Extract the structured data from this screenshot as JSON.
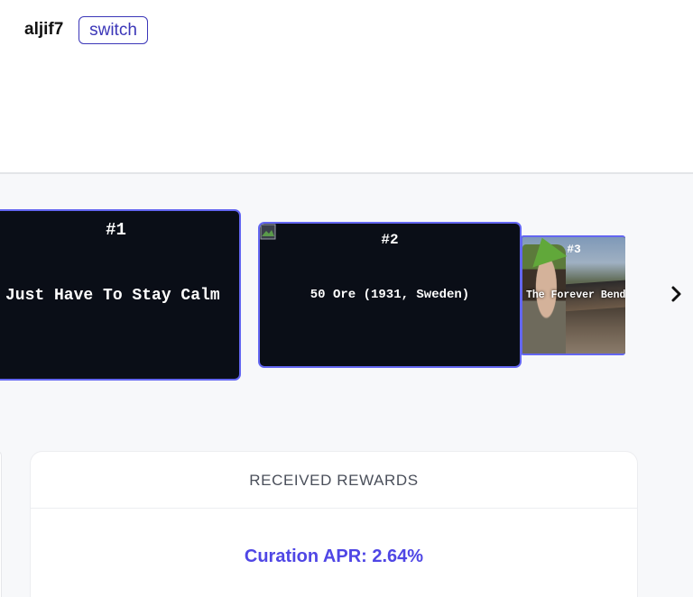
{
  "header": {
    "username": "aljif7",
    "switch_label": "switch"
  },
  "carousel": {
    "cards": [
      {
        "rank": "#1",
        "title": "Just Have To Stay Calm"
      },
      {
        "rank": "#2",
        "title": "50 Ore (1931, Sweden)",
        "thumbnail": "broken-image-icon"
      },
      {
        "rank": "#3",
        "title": "The Forever Bend",
        "thumbnail": "video-thumbnail"
      }
    ],
    "next_icon": "chevron-right-icon"
  },
  "rewards": {
    "heading": "RECEIVED REWARDS",
    "curation_apr_label": "Curation APR:",
    "curation_apr_value": "2.64%"
  },
  "colors": {
    "accent": "#4f46e5",
    "card_border": "#6366f1",
    "card_bg": "#0a0e17"
  }
}
